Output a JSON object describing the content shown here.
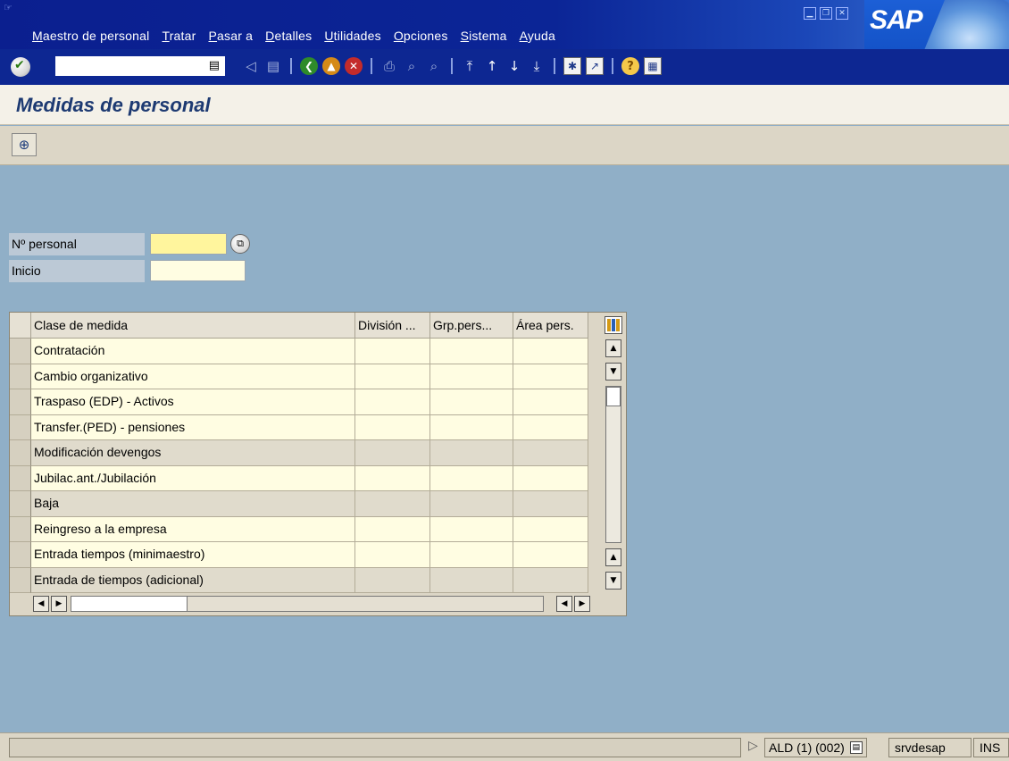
{
  "menu": {
    "items": [
      {
        "label": "Maestro de personal"
      },
      {
        "label": "Tratar"
      },
      {
        "label": "Pasar a"
      },
      {
        "label": "Detalles"
      },
      {
        "label": "Utilidades"
      },
      {
        "label": "Opciones"
      },
      {
        "label": "Sistema"
      },
      {
        "label": "Ayuda"
      }
    ]
  },
  "logo": {
    "text": "SAP"
  },
  "toolbar": {
    "command_value": "",
    "icons": [
      "enter-icon",
      "back-arrow-icon",
      "save-icon",
      "back-icon",
      "exit-icon",
      "cancel-icon",
      "print-icon",
      "find-icon",
      "find-next-icon",
      "first-page-icon",
      "previous-page-icon",
      "next-page-icon",
      "last-page-icon",
      "new-session-icon",
      "shortcut-icon",
      "help-icon",
      "layout-icon"
    ]
  },
  "page": {
    "title": "Medidas de personal"
  },
  "form": {
    "personnel_label": "Nº personal",
    "personnel_value": "",
    "start_label": "Inicio",
    "start_value": ""
  },
  "table": {
    "headers": [
      "Clase de medida",
      "División ...",
      "Grp.pers...",
      "Área pers."
    ],
    "rows": [
      {
        "measure": "Contratación",
        "division": "",
        "group": "",
        "area": ""
      },
      {
        "measure": "Cambio organizativo",
        "division": "",
        "group": "",
        "area": ""
      },
      {
        "measure": "Traspaso (EDP) - Activos",
        "division": "",
        "group": "",
        "area": ""
      },
      {
        "measure": "Transfer.(PED) - pensiones",
        "division": "",
        "group": "",
        "area": ""
      },
      {
        "measure": "Modificación devengos",
        "division": "",
        "group": "",
        "area": ""
      },
      {
        "measure": "Jubilac.ant./Jubilación",
        "division": "",
        "group": "",
        "area": ""
      },
      {
        "measure": "Baja",
        "division": "",
        "group": "",
        "area": ""
      },
      {
        "measure": "Reingreso a la empresa",
        "division": "",
        "group": "",
        "area": ""
      },
      {
        "measure": "Entrada tiempos (minimaestro)",
        "division": "",
        "group": "",
        "area": ""
      },
      {
        "measure": "Entrada de tiempos (adicional)",
        "division": "",
        "group": "",
        "area": ""
      }
    ]
  },
  "status": {
    "message": "",
    "system": "ALD (1) (002)",
    "server": "srvdesap",
    "mode": "INS"
  },
  "colors": {
    "menubar": "#0b1f8f",
    "background": "#90afc7",
    "title": "#1d3a72",
    "required_field": "#fff59d",
    "input_field": "#fffde2"
  }
}
